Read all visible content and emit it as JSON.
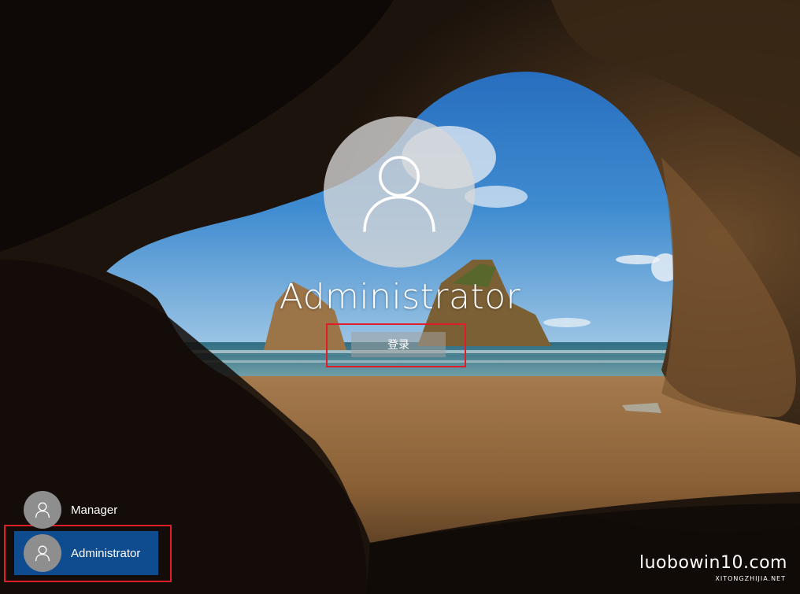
{
  "lockscreen": {
    "username": "Administrator",
    "sign_in_label": "登录"
  },
  "user_list": [
    {
      "name": "Manager",
      "selected": false
    },
    {
      "name": "Administrator",
      "selected": true
    }
  ],
  "watermark": {
    "site": "luobowin10.com",
    "subtitle": "XITONGZHIJIA.NET"
  },
  "colors": {
    "selected_user_bg": "#0f4b8f",
    "highlight_box": "#e01e2b",
    "avatar_bg": "#d7d7d7"
  }
}
